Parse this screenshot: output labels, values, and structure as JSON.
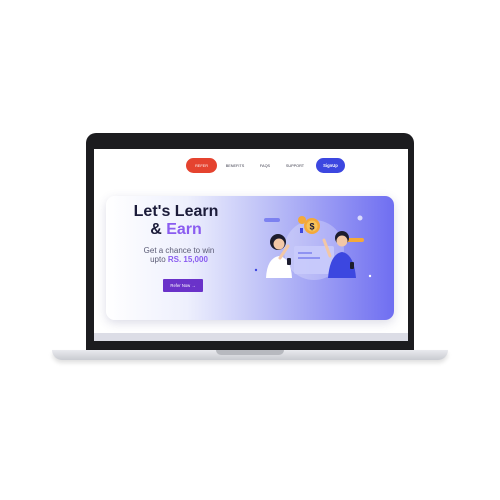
{
  "nav": {
    "refer_label": "REFER",
    "benefits_label": "BENEFITS",
    "faqs_label": "FAQS",
    "support_label": "SUPPORT",
    "signup_label": "SignUp"
  },
  "hero": {
    "title_line1": "Let's Learn",
    "title_amp": "& ",
    "title_earn": "Earn",
    "sub_line1": "Get a chance to win",
    "sub_prefix": "upto ",
    "sub_amount": "RS. 15,000",
    "cta_label": "Refer Now →"
  },
  "illustration": {
    "coin_symbol": "$"
  },
  "colors": {
    "refer_pill": "#e5432f",
    "signup_pill": "#3c47e0",
    "cta": "#6a32c9",
    "accent_text": "#8a5cf0"
  }
}
